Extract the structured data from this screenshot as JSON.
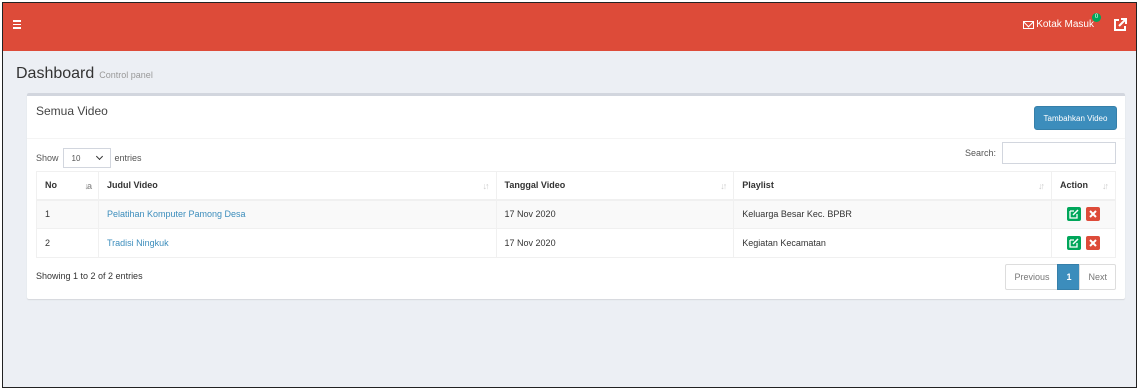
{
  "topbar": {
    "menu_icon": "hamburger-icon",
    "inbox_label": "Kotak Masuk",
    "inbox_badge": "0",
    "external_icon": "external-link-icon",
    "color": "#dd4b39"
  },
  "header": {
    "title": "Dashboard",
    "subtitle": "Control panel"
  },
  "box": {
    "title": "Semua Video",
    "add_button": "Tambahkan Video",
    "show_label": "Show",
    "entries_value": "10",
    "entries_label": "entries",
    "search_label": "Search:",
    "search_value": ""
  },
  "table": {
    "columns": [
      "No",
      "Judul Video",
      "Tanggal Video",
      "Playlist",
      "Action"
    ],
    "rows": [
      {
        "no": "1",
        "title": "Pelatihan Komputer Pamong Desa",
        "date": "17 Nov 2020",
        "playlist": "Keluarga Besar Kec. BPBR"
      },
      {
        "no": "2",
        "title": "Tradisi Ningkuk",
        "date": "17 Nov 2020",
        "playlist": "Kegiatan Kecamatan"
      }
    ]
  },
  "footer": {
    "info": "Showing 1 to 2 of 2 entries",
    "prev": "Previous",
    "page": "1",
    "next": "Next"
  },
  "colors": {
    "accent": "#3c8dbc",
    "edit": "#00a65a",
    "delete": "#dd4b39"
  }
}
